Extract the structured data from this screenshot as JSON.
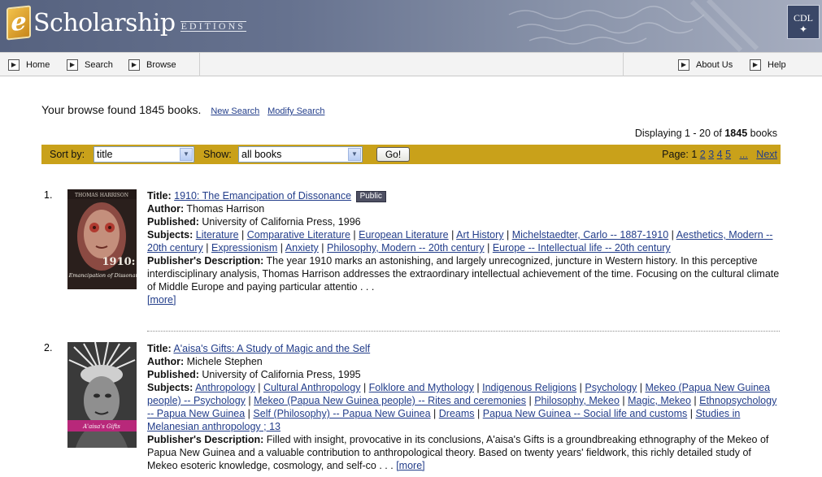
{
  "header": {
    "logo_e": "e",
    "logo_text": "Scholarship",
    "logo_subtitle": "EDITIONS",
    "badge": "CDL"
  },
  "nav": {
    "left": [
      {
        "label": "Home",
        "icon": "arrow-right-icon"
      },
      {
        "label": "Search",
        "icon": "arrow-right-icon"
      },
      {
        "label": "Browse",
        "icon": "arrow-right-icon"
      }
    ],
    "right": [
      {
        "label": "About Us",
        "icon": "arrow-right-icon"
      },
      {
        "label": "Help",
        "icon": "arrow-right-icon"
      }
    ]
  },
  "summary": {
    "prefix": "Your browse found ",
    "count": "1845",
    "suffix": " books.",
    "new_search": "New Search",
    "modify_search": "Modify Search"
  },
  "displaying": {
    "prefix": "Displaying 1 - 20 of ",
    "total": "1845",
    "suffix": " books"
  },
  "sortbar": {
    "sort_label": "Sort by:",
    "sort_value": "title",
    "show_label": "Show:",
    "show_value": "all books",
    "go_label": "Go!",
    "page_label": "Page:",
    "current_page": "1",
    "pages": [
      "2",
      "3",
      "4",
      "5"
    ],
    "ellipsis": "...",
    "next": "Next"
  },
  "field_labels": {
    "title": "Title:",
    "author": "Author:",
    "published": "Published:",
    "subjects": "Subjects:",
    "description": "Publisher's Description:",
    "more": "[more]",
    "public": "Public"
  },
  "results": [
    {
      "number": "1.",
      "title": "1910: The Emancipation of Dissonance",
      "public": true,
      "author": "Thomas Harrison",
      "published": "University of California Press,  1996",
      "cover_author": "THOMAS HARRISON",
      "cover_title_big": "1910:",
      "cover_title_small": "the Emancipation of Dissonance",
      "subjects": [
        "Literature",
        "Comparative Literature",
        "European Literature",
        "Art History",
        "Michelstaedter, Carlo -- 1887-1910",
        "Aesthetics, Modern -- 20th century",
        "Expressionism",
        "Anxiety",
        "Philosophy, Modern -- 20th century",
        "Europe -- Intellectual life -- 20th century"
      ],
      "description": "The year 1910 marks an astonishing, and largely unrecognized, juncture in Western history. In this perceptive interdisciplinary analysis, Thomas Harrison addresses the extraordinary intellectual achievement of the time. Focusing on the cultural climate of Middle Europe and paying particular attentio . . ."
    },
    {
      "number": "2.",
      "title": "A'aisa's Gifts: A Study of Magic and the Self",
      "public": false,
      "author": "Michele Stephen",
      "published": "University of California Press,  1995",
      "cover_title_small": "A'aisa's Gifts",
      "subjects": [
        "Anthropology",
        "Cultural Anthropology",
        "Folklore and Mythology",
        "Indigenous Religions",
        "Psychology",
        "Mekeo (Papua New Guinea people) -- Psychology",
        "Mekeo (Papua New Guinea people) -- Rites and ceremonies",
        "Philosophy, Mekeo",
        "Magic, Mekeo",
        "Ethnopsychology -- Papua New Guinea",
        "Self (Philosophy) -- Papua New Guinea",
        "Dreams",
        "Papua New Guinea -- Social life and customs",
        "Studies in Melanesian anthropology ; 13"
      ],
      "description": "Filled with insight, provocative in its conclusions, A'aisa's Gifts is a groundbreaking ethnography of the Mekeo of Papua New Guinea and a valuable contribution to anthropological theory. Based on twenty years' fieldwork, this richly detailed study of Mekeo esoteric knowledge, cosmology, and self-co . . ."
    }
  ]
}
